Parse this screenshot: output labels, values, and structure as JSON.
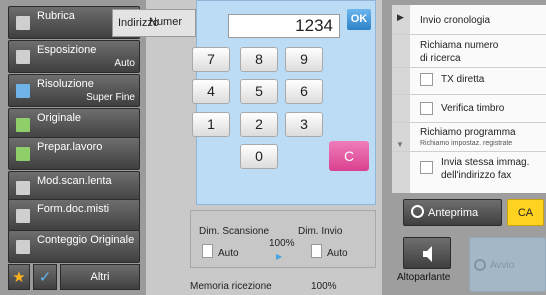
{
  "sidebar": {
    "items": [
      {
        "label": "Rubrica",
        "value": ""
      },
      {
        "label": "Esposizione",
        "value": "Auto"
      },
      {
        "label": "Risoluzione",
        "value": "Super Fine"
      },
      {
        "label": "Originale",
        "value": ""
      },
      {
        "label": "Prepar.lavoro",
        "value": ""
      },
      {
        "label": "Mod.scan.lenta",
        "value": ""
      },
      {
        "label": "Form.doc.misti",
        "value": ""
      },
      {
        "label": "Conteggio Originale",
        "value": ""
      }
    ],
    "bottom": {
      "other_label": "Altri"
    }
  },
  "header": {
    "address_label": "Indirizzo",
    "number_label": "Numer"
  },
  "keypad": {
    "display_value": "1234",
    "ok_label": "OK",
    "keys": [
      "7",
      "8",
      "9",
      "4",
      "5",
      "6",
      "1",
      "2",
      "3",
      "0"
    ],
    "clear_label": "C"
  },
  "center": {
    "scan_size_label": "Dim. Scansione",
    "scan_size_value": "Auto",
    "send_size_label": "Dim. Invio",
    "send_size_value": "Auto",
    "ratio": "100%",
    "memory_label": "Memoria ricezione",
    "memory_value": "100%"
  },
  "right_panel": {
    "send_history": "Invio cronologia",
    "recall_number": "Richiama numero\ndi ricerca",
    "tx_direct": "TX diretta",
    "verify_stamp": "Verifica timbro",
    "recall_program": "Richiamo programma",
    "recall_program_sub": "Richiamo impostaz. registrate",
    "send_same_image": "Invia stessa immag.\ndell'indirizzo fax",
    "preview": "Anteprima",
    "ca": "CA",
    "speaker": "Altoparlante",
    "send": "Avvio"
  },
  "colors": {
    "accent_blue": "#4aa3df",
    "clear_pink": "#e85aa6",
    "ca_yellow": "#ffd21f",
    "keypad_bg": "#bcdcf6"
  }
}
